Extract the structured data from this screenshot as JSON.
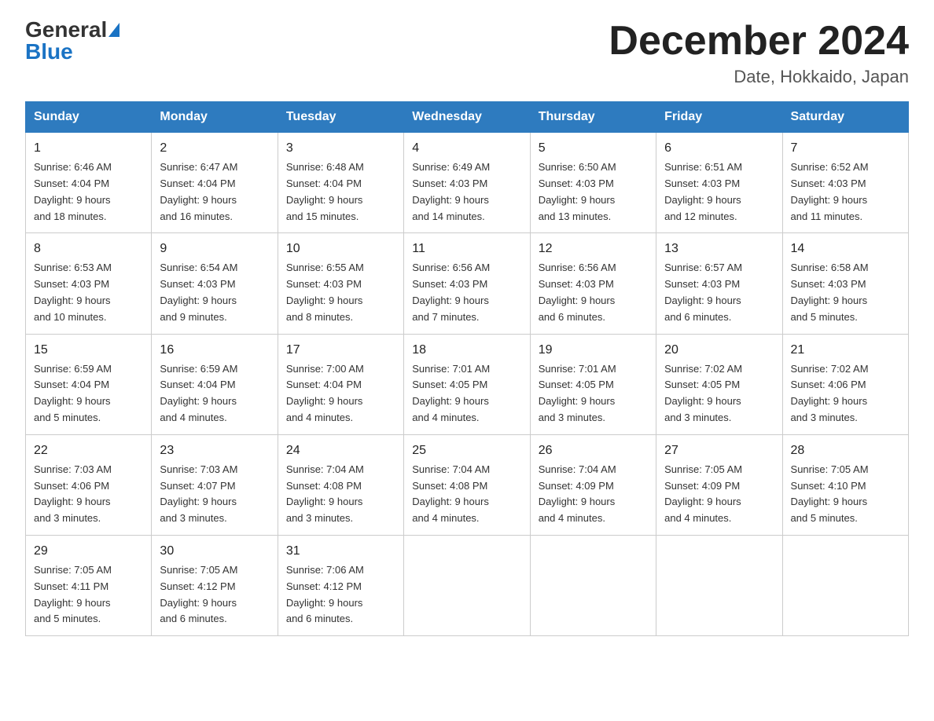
{
  "header": {
    "logo_general": "General",
    "logo_blue": "Blue",
    "title": "December 2024",
    "subtitle": "Date, Hokkaido, Japan"
  },
  "days_of_week": [
    "Sunday",
    "Monday",
    "Tuesday",
    "Wednesday",
    "Thursday",
    "Friday",
    "Saturday"
  ],
  "weeks": [
    [
      {
        "day": "1",
        "sunrise": "6:46 AM",
        "sunset": "4:04 PM",
        "daylight": "9 hours and 18 minutes."
      },
      {
        "day": "2",
        "sunrise": "6:47 AM",
        "sunset": "4:04 PM",
        "daylight": "9 hours and 16 minutes."
      },
      {
        "day": "3",
        "sunrise": "6:48 AM",
        "sunset": "4:04 PM",
        "daylight": "9 hours and 15 minutes."
      },
      {
        "day": "4",
        "sunrise": "6:49 AM",
        "sunset": "4:03 PM",
        "daylight": "9 hours and 14 minutes."
      },
      {
        "day": "5",
        "sunrise": "6:50 AM",
        "sunset": "4:03 PM",
        "daylight": "9 hours and 13 minutes."
      },
      {
        "day": "6",
        "sunrise": "6:51 AM",
        "sunset": "4:03 PM",
        "daylight": "9 hours and 12 minutes."
      },
      {
        "day": "7",
        "sunrise": "6:52 AM",
        "sunset": "4:03 PM",
        "daylight": "9 hours and 11 minutes."
      }
    ],
    [
      {
        "day": "8",
        "sunrise": "6:53 AM",
        "sunset": "4:03 PM",
        "daylight": "9 hours and 10 minutes."
      },
      {
        "day": "9",
        "sunrise": "6:54 AM",
        "sunset": "4:03 PM",
        "daylight": "9 hours and 9 minutes."
      },
      {
        "day": "10",
        "sunrise": "6:55 AM",
        "sunset": "4:03 PM",
        "daylight": "9 hours and 8 minutes."
      },
      {
        "day": "11",
        "sunrise": "6:56 AM",
        "sunset": "4:03 PM",
        "daylight": "9 hours and 7 minutes."
      },
      {
        "day": "12",
        "sunrise": "6:56 AM",
        "sunset": "4:03 PM",
        "daylight": "9 hours and 6 minutes."
      },
      {
        "day": "13",
        "sunrise": "6:57 AM",
        "sunset": "4:03 PM",
        "daylight": "9 hours and 6 minutes."
      },
      {
        "day": "14",
        "sunrise": "6:58 AM",
        "sunset": "4:03 PM",
        "daylight": "9 hours and 5 minutes."
      }
    ],
    [
      {
        "day": "15",
        "sunrise": "6:59 AM",
        "sunset": "4:04 PM",
        "daylight": "9 hours and 5 minutes."
      },
      {
        "day": "16",
        "sunrise": "6:59 AM",
        "sunset": "4:04 PM",
        "daylight": "9 hours and 4 minutes."
      },
      {
        "day": "17",
        "sunrise": "7:00 AM",
        "sunset": "4:04 PM",
        "daylight": "9 hours and 4 minutes."
      },
      {
        "day": "18",
        "sunrise": "7:01 AM",
        "sunset": "4:05 PM",
        "daylight": "9 hours and 4 minutes."
      },
      {
        "day": "19",
        "sunrise": "7:01 AM",
        "sunset": "4:05 PM",
        "daylight": "9 hours and 3 minutes."
      },
      {
        "day": "20",
        "sunrise": "7:02 AM",
        "sunset": "4:05 PM",
        "daylight": "9 hours and 3 minutes."
      },
      {
        "day": "21",
        "sunrise": "7:02 AM",
        "sunset": "4:06 PM",
        "daylight": "9 hours and 3 minutes."
      }
    ],
    [
      {
        "day": "22",
        "sunrise": "7:03 AM",
        "sunset": "4:06 PM",
        "daylight": "9 hours and 3 minutes."
      },
      {
        "day": "23",
        "sunrise": "7:03 AM",
        "sunset": "4:07 PM",
        "daylight": "9 hours and 3 minutes."
      },
      {
        "day": "24",
        "sunrise": "7:04 AM",
        "sunset": "4:08 PM",
        "daylight": "9 hours and 3 minutes."
      },
      {
        "day": "25",
        "sunrise": "7:04 AM",
        "sunset": "4:08 PM",
        "daylight": "9 hours and 4 minutes."
      },
      {
        "day": "26",
        "sunrise": "7:04 AM",
        "sunset": "4:09 PM",
        "daylight": "9 hours and 4 minutes."
      },
      {
        "day": "27",
        "sunrise": "7:05 AM",
        "sunset": "4:09 PM",
        "daylight": "9 hours and 4 minutes."
      },
      {
        "day": "28",
        "sunrise": "7:05 AM",
        "sunset": "4:10 PM",
        "daylight": "9 hours and 5 minutes."
      }
    ],
    [
      {
        "day": "29",
        "sunrise": "7:05 AM",
        "sunset": "4:11 PM",
        "daylight": "9 hours and 5 minutes."
      },
      {
        "day": "30",
        "sunrise": "7:05 AM",
        "sunset": "4:12 PM",
        "daylight": "9 hours and 6 minutes."
      },
      {
        "day": "31",
        "sunrise": "7:06 AM",
        "sunset": "4:12 PM",
        "daylight": "9 hours and 6 minutes."
      },
      null,
      null,
      null,
      null
    ]
  ],
  "labels": {
    "sunrise": "Sunrise:",
    "sunset": "Sunset:",
    "daylight": "Daylight:"
  }
}
